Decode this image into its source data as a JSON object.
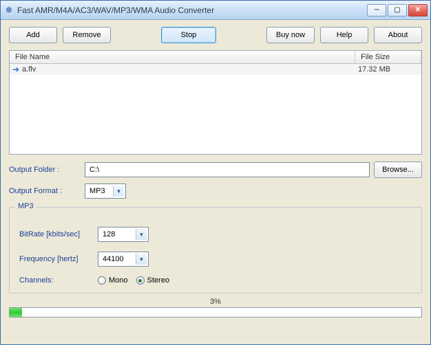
{
  "window": {
    "title": "Fast AMR/M4A/AC3/WAV/MP3/WMA Audio Converter"
  },
  "toolbar": {
    "add": "Add",
    "remove": "Remove",
    "stop": "Stop",
    "buynow": "Buy now",
    "help": "Help",
    "about": "About"
  },
  "list": {
    "col_filename": "File Name",
    "col_filesize": "File Size",
    "rows": [
      {
        "name": "a.flv",
        "size": "17.32 MB"
      }
    ]
  },
  "output_folder": {
    "label": "Output Folder :",
    "value": "C:\\",
    "browse": "Browse..."
  },
  "output_format": {
    "label": "Output Format :",
    "value": "MP3"
  },
  "group": {
    "legend": "MP3",
    "bitrate_label": "BitRate [kbits/sec]",
    "bitrate_value": "128",
    "frequency_label": "Frequency [hertz]",
    "frequency_value": "44100",
    "channels_label": "Channels:",
    "mono": "Mono",
    "stereo": "Stereo",
    "channels_selected": "stereo"
  },
  "progress": {
    "text": "3%",
    "percent": 3
  }
}
